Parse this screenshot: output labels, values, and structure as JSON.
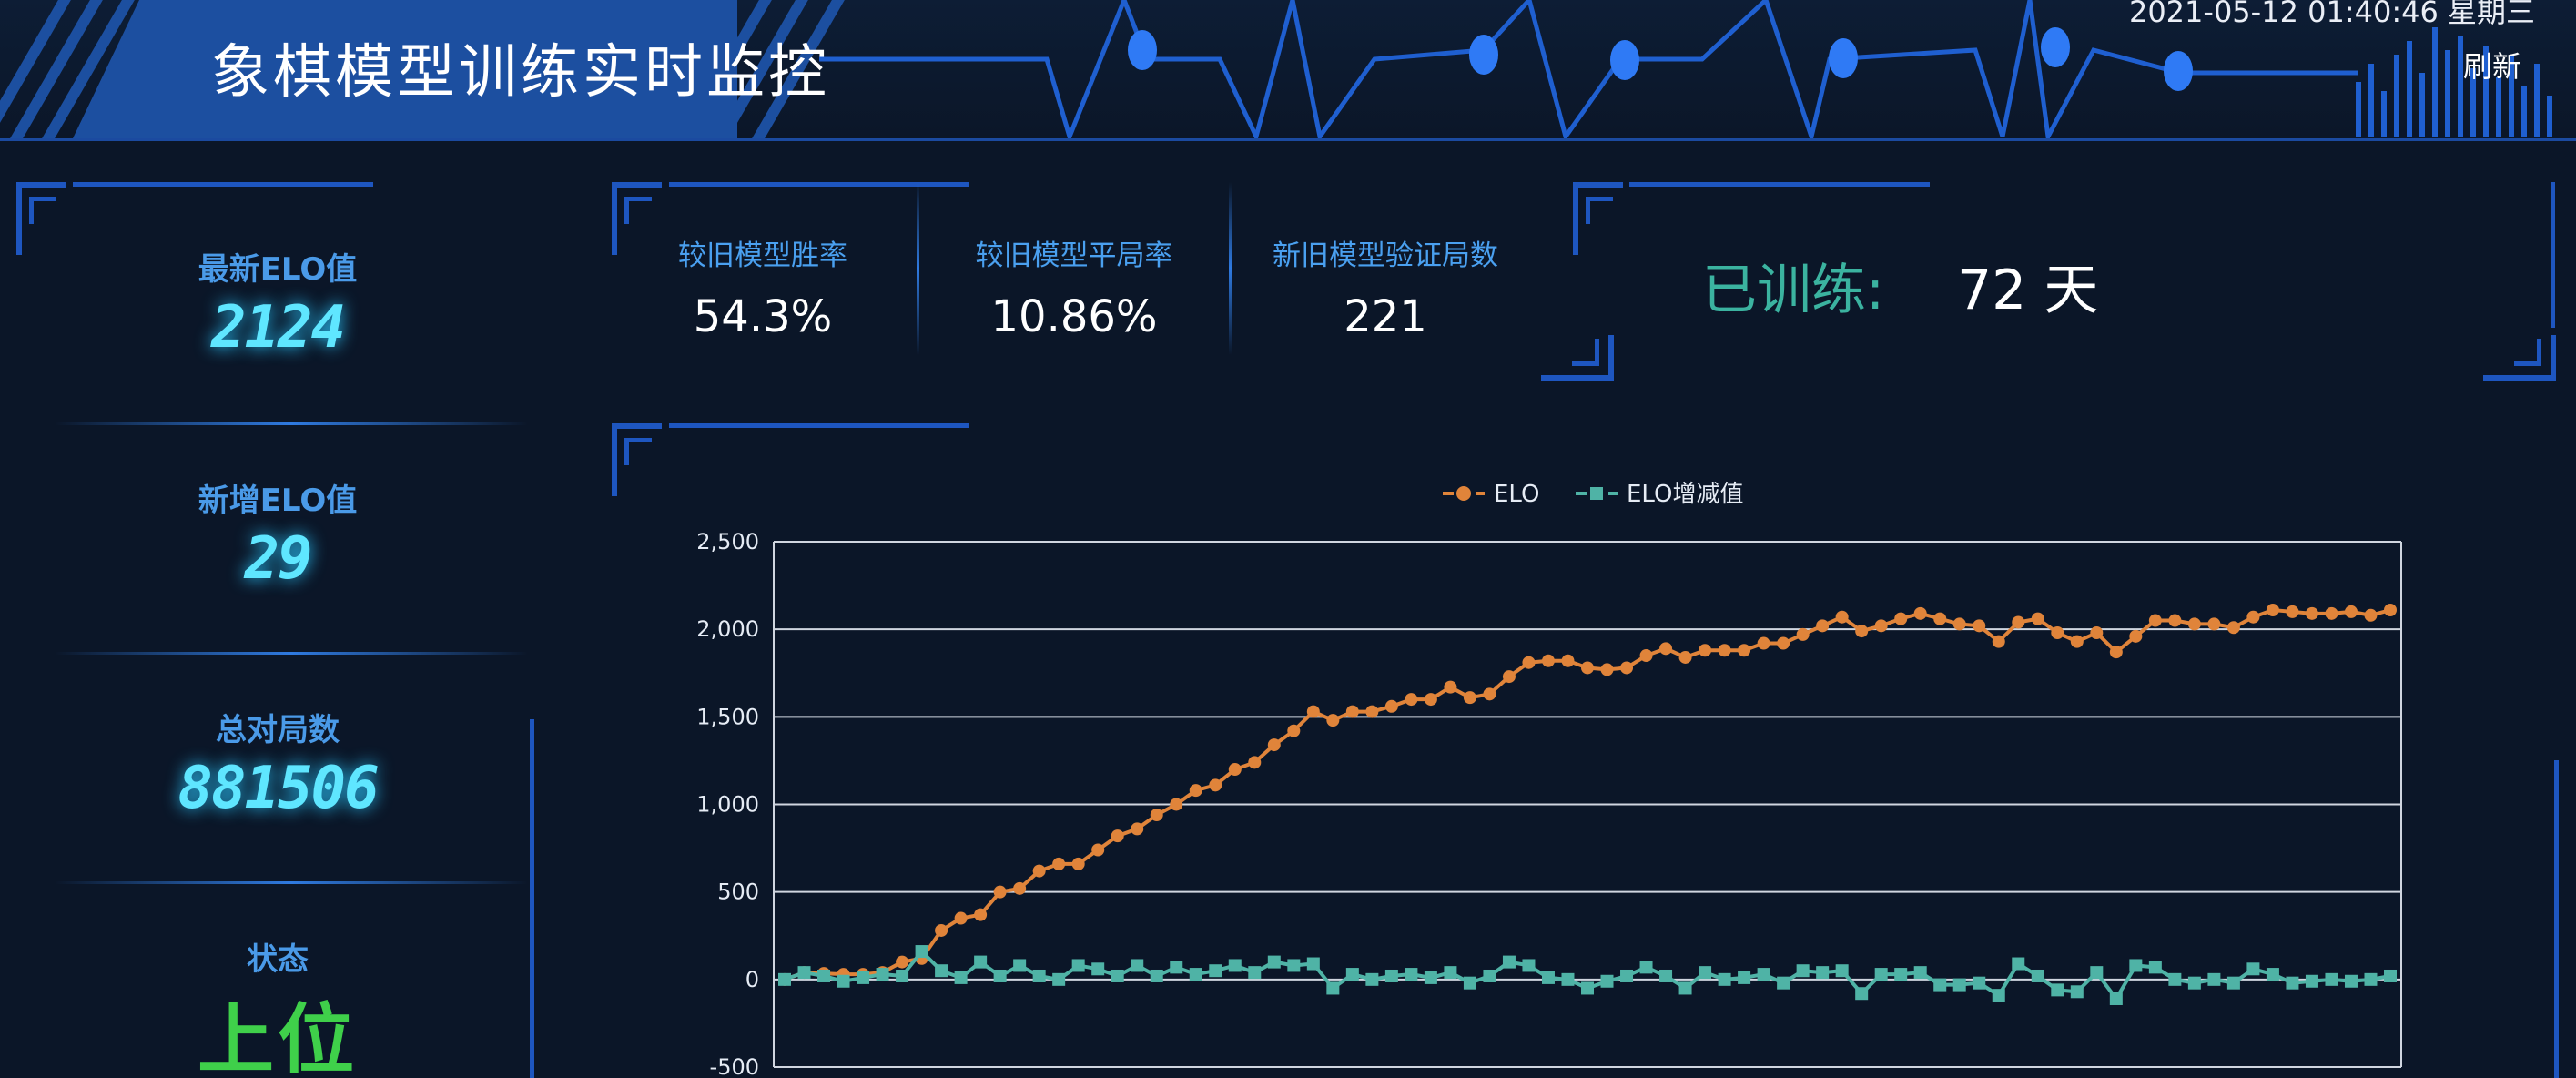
{
  "header": {
    "title": "象棋模型训练实时监控",
    "datetime": "2021-05-12 01:40:46 星期三",
    "refresh_label": "刷新"
  },
  "stats": {
    "latest_elo": {
      "label": "最新ELO值",
      "value": "2124"
    },
    "new_elo": {
      "label": "新增ELO值",
      "value": "29"
    },
    "total_games": {
      "label": "总对局数",
      "value": "881506"
    },
    "status": {
      "label": "状态",
      "value": "上位"
    }
  },
  "metrics": [
    {
      "label": "较旧模型胜率",
      "value": "54.3%"
    },
    {
      "label": "较旧模型平局率",
      "value": "10.86%"
    },
    {
      "label": "新旧模型验证局数",
      "value": "221"
    }
  ],
  "trained": {
    "label": "已训练:",
    "value": "72 天"
  },
  "colors": {
    "background": "#0b1628",
    "accent_blue": "#1e56c0",
    "title_plate": "#1c4fa0",
    "elo_line": "#e0843a",
    "delta_line": "#4fb3a6",
    "digital": "#5fe6ff",
    "status_green": "#3fd04a"
  },
  "chart_data": {
    "type": "line",
    "ylim": [
      -500,
      2500
    ],
    "yticks": [
      -500,
      0,
      500,
      1000,
      1500,
      2000,
      2500
    ],
    "ytick_labels": [
      "-500",
      "0",
      "500",
      "1,000",
      "1,500",
      "2,000",
      "2,500"
    ],
    "grid": true,
    "legend": "top-center",
    "series": [
      {
        "name": "ELO",
        "color": "#e0843a",
        "marker": "circle",
        "values": [
          0,
          40,
          35,
          30,
          30,
          40,
          100,
          120,
          280,
          350,
          370,
          500,
          520,
          620,
          660,
          660,
          740,
          820,
          860,
          940,
          1000,
          1080,
          1110,
          1200,
          1240,
          1340,
          1420,
          1530,
          1480,
          1530,
          1530,
          1560,
          1600,
          1600,
          1670,
          1610,
          1630,
          1730,
          1810,
          1820,
          1820,
          1780,
          1770,
          1780,
          1850,
          1890,
          1840,
          1880,
          1880,
          1880,
          1920,
          1920,
          1970,
          2020,
          2070,
          1990,
          2020,
          2060,
          2090,
          2060,
          2030,
          2020,
          1930,
          2040,
          2060,
          1980,
          1930,
          1980,
          1870,
          1960,
          2050,
          2050,
          2030,
          2030,
          2010,
          2070,
          2110,
          2100,
          2090,
          2090,
          2100,
          2080,
          2110
        ]
      },
      {
        "name": "ELO增减值",
        "color": "#4fb3a6",
        "marker": "square",
        "values": [
          0,
          40,
          20,
          -10,
          10,
          30,
          20,
          160,
          50,
          10,
          100,
          20,
          80,
          20,
          0,
          80,
          60,
          20,
          80,
          20,
          70,
          30,
          50,
          80,
          40,
          100,
          80,
          90,
          -50,
          30,
          0,
          20,
          30,
          10,
          40,
          -20,
          20,
          100,
          80,
          10,
          0,
          -50,
          -10,
          20,
          70,
          20,
          -50,
          40,
          0,
          10,
          30,
          -20,
          50,
          40,
          50,
          -80,
          30,
          30,
          40,
          -30,
          -30,
          -20,
          -90,
          90,
          20,
          -60,
          -70,
          40,
          -110,
          80,
          70,
          0,
          -20,
          0,
          -20,
          60,
          30,
          -20,
          -10,
          0,
          -10,
          0,
          20
        ]
      }
    ]
  }
}
